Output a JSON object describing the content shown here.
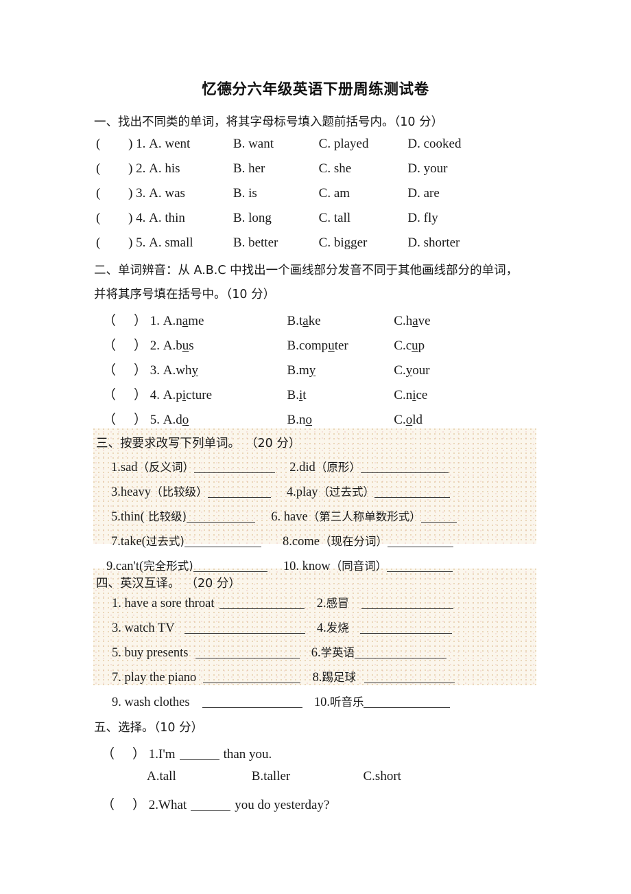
{
  "document": {
    "title": "忆德分六年级英语下册周练测试卷"
  },
  "sections": [
    {
      "id": "section-1",
      "heading_cn": "一、找出不同类的单词，将其字母标号填入题前括号内。",
      "heading_score": "（10 分）",
      "type": "multiple-choice-4",
      "questions": [
        {
          "paren": "(",
          "paren_close": ")",
          "number": "1.",
          "options": [
            "A. went",
            "B. want",
            "C. played",
            "D. cooked"
          ]
        },
        {
          "paren": "(",
          "paren_close": ")",
          "number": "2.",
          "options": [
            "A. his",
            "B. her",
            "C. she",
            "D. your"
          ]
        },
        {
          "paren": "(",
          "paren_close": ")",
          "number": "3.",
          "options": [
            "A. was",
            "B. is",
            "C. am",
            "D. are"
          ]
        },
        {
          "paren": "(",
          "paren_close": ")",
          "number": "4.",
          "options": [
            "A. thin",
            "B. long",
            "C. tall",
            "D. fly"
          ]
        },
        {
          "paren": "(",
          "paren_close": ")",
          "number": "5.",
          "options": [
            "A. small",
            "B. better",
            "C. bigger",
            "D. shorter"
          ]
        }
      ]
    },
    {
      "id": "section-2",
      "heading_cn_line1": "二、单词辨音：从 A.B.C 中找出一个画线部分发音不同于其他画线部分的单词，",
      "heading_cn_line2": "并将其序号填在括号中。",
      "heading_score": "（10 分）",
      "type": "multiple-choice-3-underlined",
      "questions": [
        {
          "number": "1.",
          "options": [
            {
              "label": "A.",
              "pre": "n",
              "mark": "a",
              "post": "me"
            },
            {
              "label": "B.",
              "pre": "t",
              "mark": "a",
              "post": "ke"
            },
            {
              "label": "C.",
              "pre": "h",
              "mark": "a",
              "post": "ve"
            }
          ]
        },
        {
          "number": "2.",
          "options": [
            {
              "label": "A.",
              "pre": "b",
              "mark": "u",
              "post": "s"
            },
            {
              "label": "B.",
              "pre": "comp",
              "mark": "u",
              "post": "ter"
            },
            {
              "label": "C.",
              "pre": "c",
              "mark": "u",
              "post": "p"
            }
          ]
        },
        {
          "number": "3.",
          "options": [
            {
              "label": "A.",
              "pre": "wh",
              "mark": "y",
              "post": ""
            },
            {
              "label": "B.",
              "pre": "m",
              "mark": "y",
              "post": ""
            },
            {
              "label": "C.",
              "pre": "",
              "mark": "y",
              "post": "our"
            }
          ]
        },
        {
          "number": "4.",
          "options": [
            {
              "label": "A.",
              "pre": "p",
              "mark": "i",
              "post": "cture"
            },
            {
              "label": "B.",
              "pre": "",
              "mark": "i",
              "post": "t"
            },
            {
              "label": "C.",
              "pre": "n",
              "mark": "i",
              "post": "ce"
            }
          ]
        },
        {
          "number": "5.",
          "options": [
            {
              "label": "A.",
              "pre": "d",
              "mark": "o",
              "post": ""
            },
            {
              "label": "B.",
              "pre": "n",
              "mark": "o",
              "post": ""
            },
            {
              "label": "C.",
              "pre": "",
              "mark": "o",
              "post": "ld"
            }
          ]
        }
      ]
    },
    {
      "id": "section-3",
      "heading_cn": "三、按要求改写下列单词。",
      "heading_score": "（20 分）",
      "type": "fill-in-blank-2col",
      "items": [
        {
          "number": "1.",
          "word": "sad",
          "hint": "（反义词）"
        },
        {
          "number": "2.",
          "word": "did",
          "hint": "（原形）"
        },
        {
          "number": "3.",
          "word": "heavy",
          "hint": "（比较级）"
        },
        {
          "number": "4.",
          "word": "play",
          "hint": "（过去式）"
        },
        {
          "number": "5.",
          "word": "thin(",
          "hint": " 比较级)"
        },
        {
          "number": "6.",
          "word": " have",
          "hint": "（第三人称单数形式）"
        },
        {
          "number": "7.",
          "word": "take(",
          "hint": "过去式)"
        },
        {
          "number": "8.",
          "word": "come",
          "hint": "（现在分词）"
        },
        {
          "number": "9.",
          "word": "can't(",
          "hint": "完全形式)"
        },
        {
          "number": "10.",
          "word": " know",
          "hint": "（同音词）"
        }
      ]
    },
    {
      "id": "section-4",
      "heading_cn": "四、英汉互译。",
      "heading_score": "（20 分）",
      "type": "translation-2col",
      "items": [
        {
          "number": "1.",
          "text": " have a sore throat",
          "lang": "en"
        },
        {
          "number": "2.",
          "text": "感冒",
          "lang": "cn"
        },
        {
          "number": "3.",
          "text": " watch TV",
          "lang": "en"
        },
        {
          "number": "4.",
          "text": "发烧",
          "lang": "cn"
        },
        {
          "number": "5.",
          "text": " buy presents",
          "lang": "en"
        },
        {
          "number": "6.",
          "text": "学英语",
          "lang": "cn"
        },
        {
          "number": "7.",
          "text": " play the piano",
          "lang": "en"
        },
        {
          "number": "8.",
          "text": "踢足球",
          "lang": "cn"
        },
        {
          "number": "9.",
          "text": " wash clothes",
          "lang": "en"
        },
        {
          "number": "10.",
          "text": "听音乐",
          "lang": "cn"
        }
      ]
    },
    {
      "id": "section-5",
      "heading_cn": "五、选择。",
      "heading_score": "（10 分）",
      "type": "multiple-choice-3",
      "questions": [
        {
          "number": "1.",
          "stem_pre": "I'm",
          "stem_post": "than you.",
          "options": [
            "A.tall",
            "B.taller",
            "C.short"
          ]
        },
        {
          "number": "2.",
          "stem_pre": "What",
          "stem_post": "you do yesterday?",
          "options": []
        }
      ]
    }
  ]
}
